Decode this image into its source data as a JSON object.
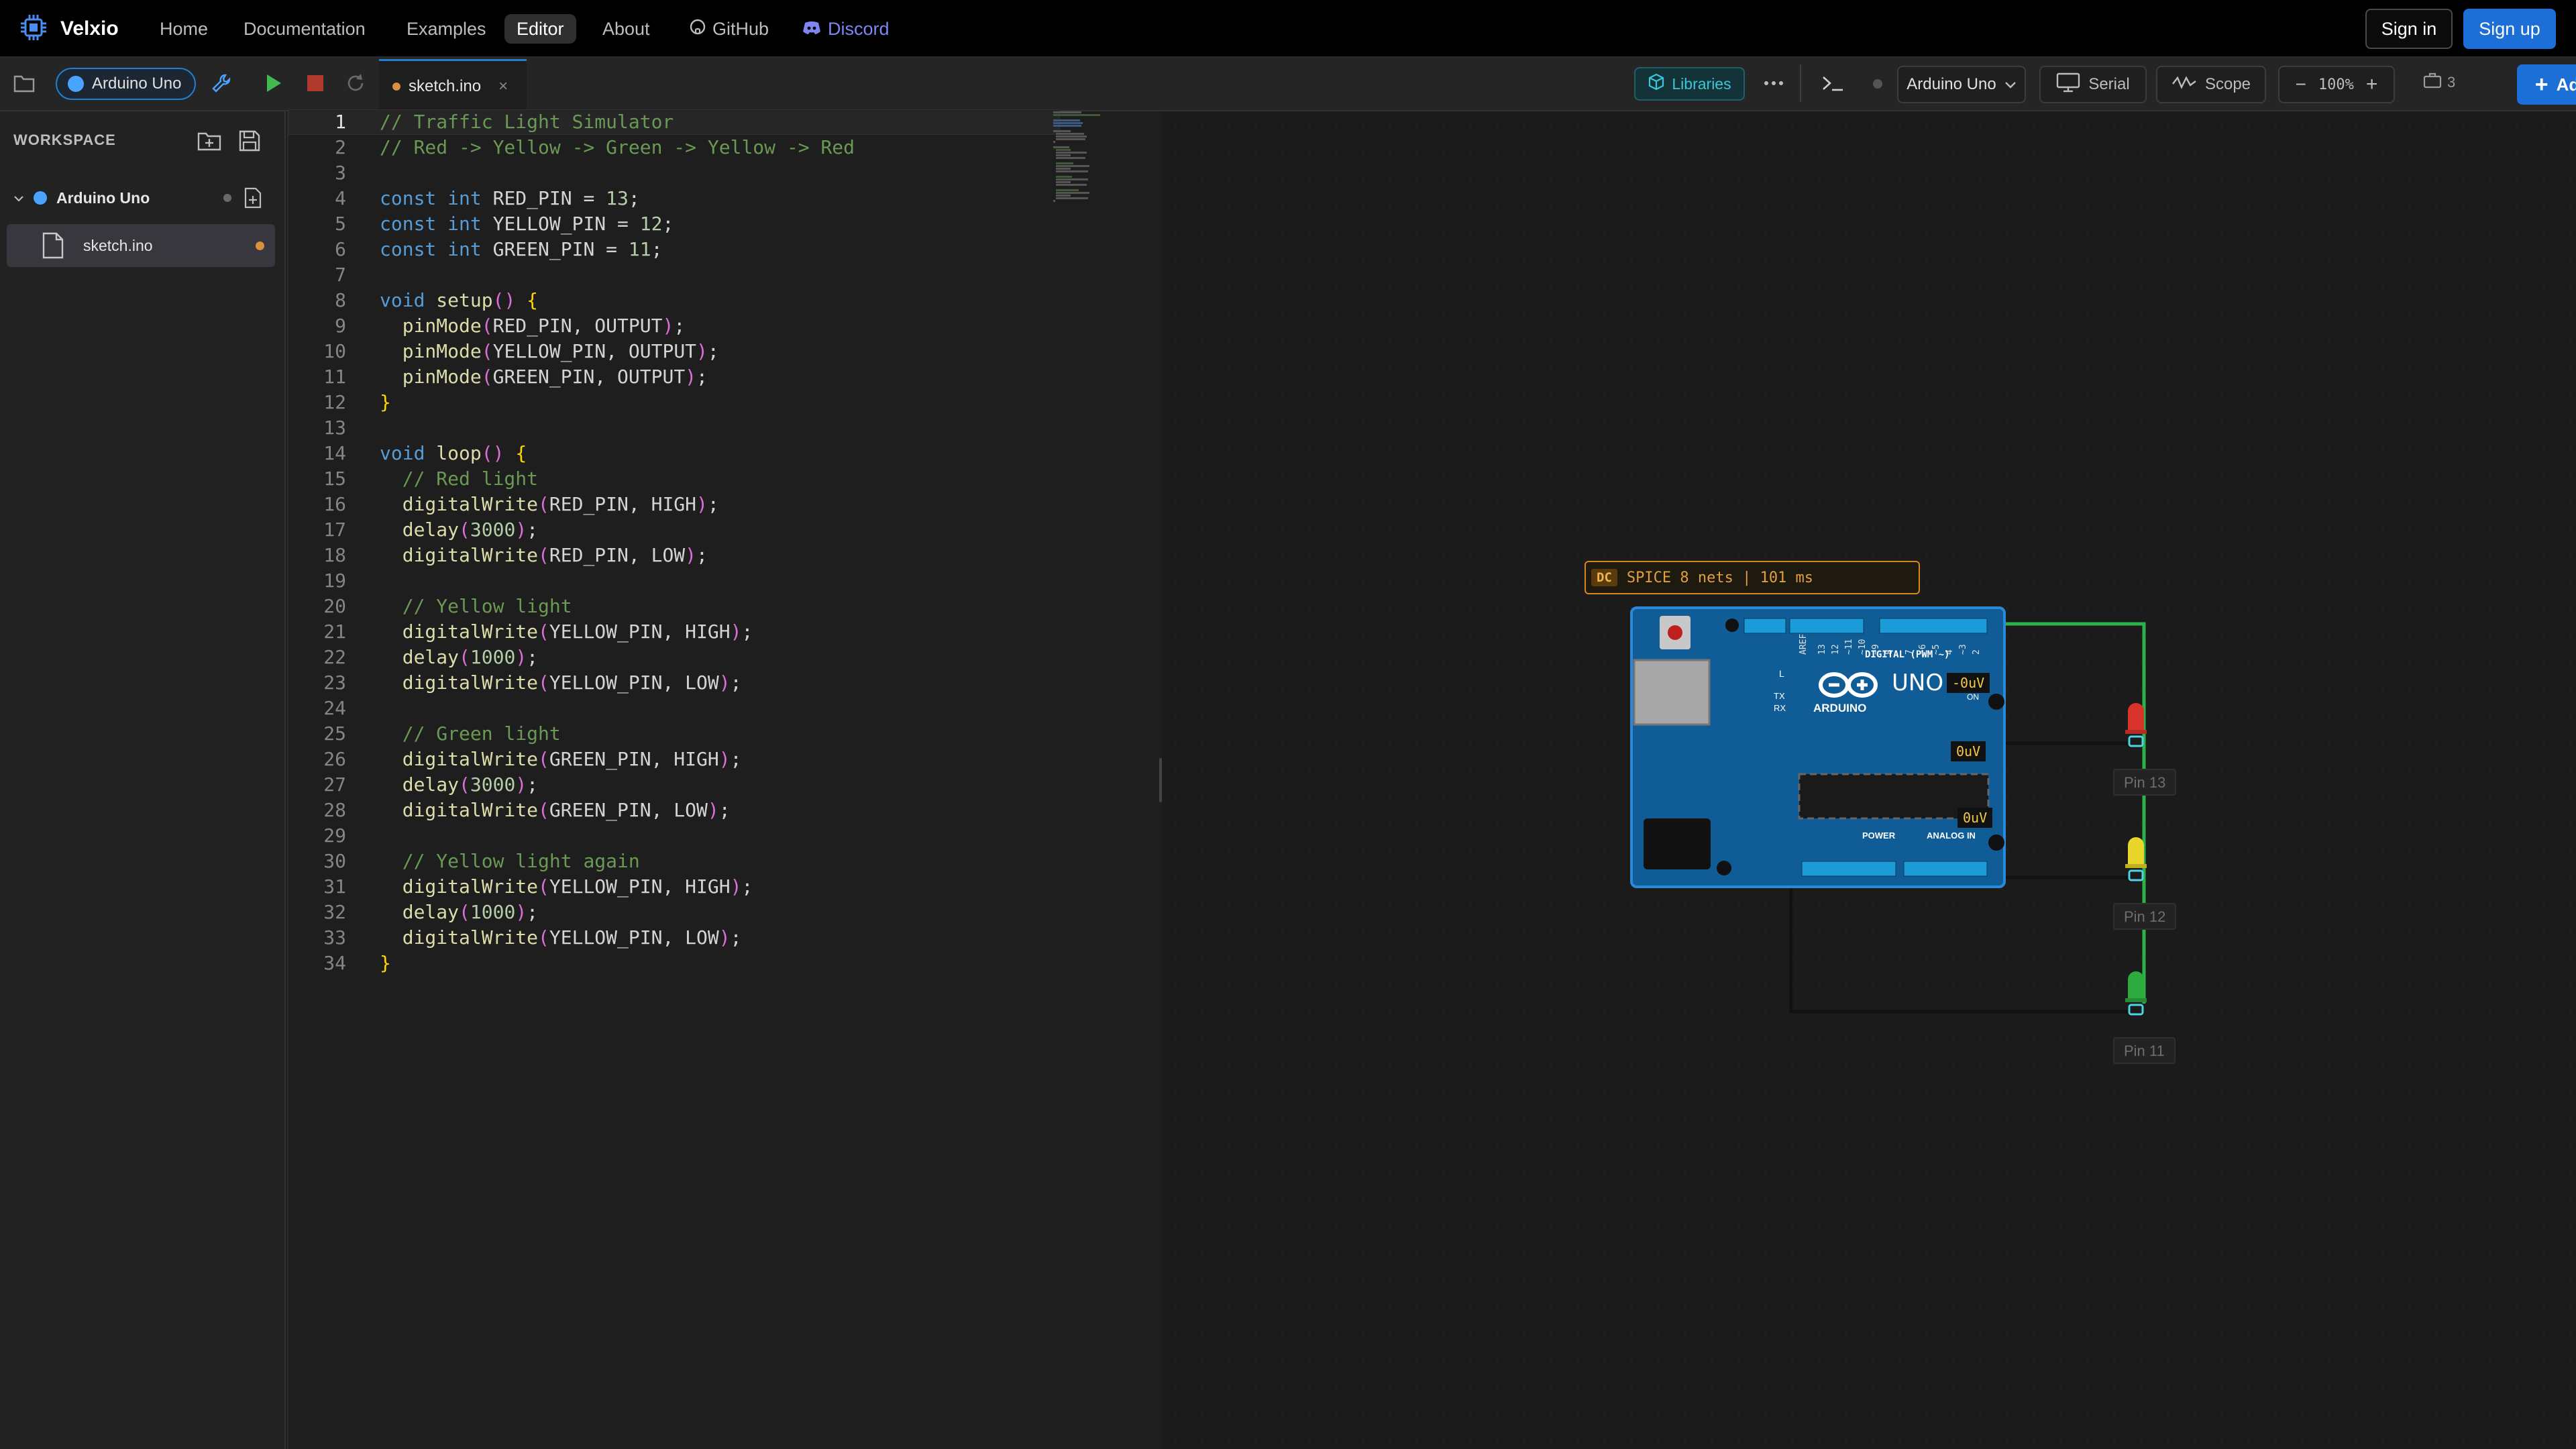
{
  "app": {
    "name": "Velxio"
  },
  "nav": {
    "links": [
      "Home",
      "Documentation",
      "Examples",
      "Editor",
      "About",
      "GitHub",
      "Discord"
    ],
    "sign_in": "Sign in",
    "sign_up": "Sign up"
  },
  "toolbar": {
    "board_pill": "Arduino Uno",
    "tab_name": "sketch.ino",
    "tab_close": "×",
    "libraries": "Libraries",
    "board_select": "Arduino Uno",
    "serial": "Serial",
    "scope": "Scope",
    "zoom": "100%",
    "component_count": "3",
    "add": "Add",
    "colors": {
      "accent": "#1b6fd6",
      "libraries": "#3cc6d6",
      "run": "#3fb950",
      "stop": "#c0392b"
    }
  },
  "sidebar": {
    "title": "WORKSPACE",
    "board": "Arduino Uno",
    "file": "sketch.ino"
  },
  "editor": {
    "lines": [
      {
        "n": "1",
        "code": "// Traffic Light Simulator"
      },
      {
        "n": "2",
        "code": "// Red -> Yellow -> Green -> Yellow -> Red"
      },
      {
        "n": "3",
        "code": ""
      },
      {
        "n": "4",
        "code": "const int RED_PIN = 13;"
      },
      {
        "n": "5",
        "code": "const int YELLOW_PIN = 12;"
      },
      {
        "n": "6",
        "code": "const int GREEN_PIN = 11;"
      },
      {
        "n": "7",
        "code": ""
      },
      {
        "n": "8",
        "code": "void setup() {"
      },
      {
        "n": "9",
        "code": "  pinMode(RED_PIN, OUTPUT);"
      },
      {
        "n": "10",
        "code": "  pinMode(YELLOW_PIN, OUTPUT);"
      },
      {
        "n": "11",
        "code": "  pinMode(GREEN_PIN, OUTPUT);"
      },
      {
        "n": "12",
        "code": "}"
      },
      {
        "n": "13",
        "code": ""
      },
      {
        "n": "14",
        "code": "void loop() {"
      },
      {
        "n": "15",
        "code": "  // Red light"
      },
      {
        "n": "16",
        "code": "  digitalWrite(RED_PIN, HIGH);"
      },
      {
        "n": "17",
        "code": "  delay(3000);"
      },
      {
        "n": "18",
        "code": "  digitalWrite(RED_PIN, LOW);"
      },
      {
        "n": "19",
        "code": ""
      },
      {
        "n": "20",
        "code": "  // Yellow light"
      },
      {
        "n": "21",
        "code": "  digitalWrite(YELLOW_PIN, HIGH);"
      },
      {
        "n": "22",
        "code": "  delay(1000);"
      },
      {
        "n": "23",
        "code": "  digitalWrite(YELLOW_PIN, LOW);"
      },
      {
        "n": "24",
        "code": ""
      },
      {
        "n": "25",
        "code": "  // Green light"
      },
      {
        "n": "26",
        "code": "  digitalWrite(GREEN_PIN, HIGH);"
      },
      {
        "n": "27",
        "code": "  delay(3000);"
      },
      {
        "n": "28",
        "code": "  digitalWrite(GREEN_PIN, LOW);"
      },
      {
        "n": "29",
        "code": ""
      },
      {
        "n": "30",
        "code": "  // Yellow light again"
      },
      {
        "n": "31",
        "code": "  digitalWrite(YELLOW_PIN, HIGH);"
      },
      {
        "n": "32",
        "code": "  delay(1000);"
      },
      {
        "n": "33",
        "code": "  digitalWrite(YELLOW_PIN, LOW);"
      },
      {
        "n": "34",
        "code": "}"
      }
    ]
  },
  "simulation": {
    "spice_tag": "DC",
    "spice_text": "SPICE 8 nets | 101 ms",
    "volt_readouts": [
      "-0uV",
      "0uV",
      "0uV"
    ],
    "board_text": {
      "uno": "UNO",
      "arduino": "ARDUINO",
      "digital": "DIGITAL (PWM ~)",
      "power": "POWER",
      "analog": "ANALOG IN",
      "on": "ON",
      "l": "L",
      "tx": "TX",
      "rx": "RX",
      "aref": "AREF"
    },
    "led_labels": [
      "Pin 13",
      "Pin 12",
      "Pin 11"
    ],
    "led_colors": [
      "#d9342b",
      "#e8d62a",
      "#2faa3e"
    ]
  }
}
